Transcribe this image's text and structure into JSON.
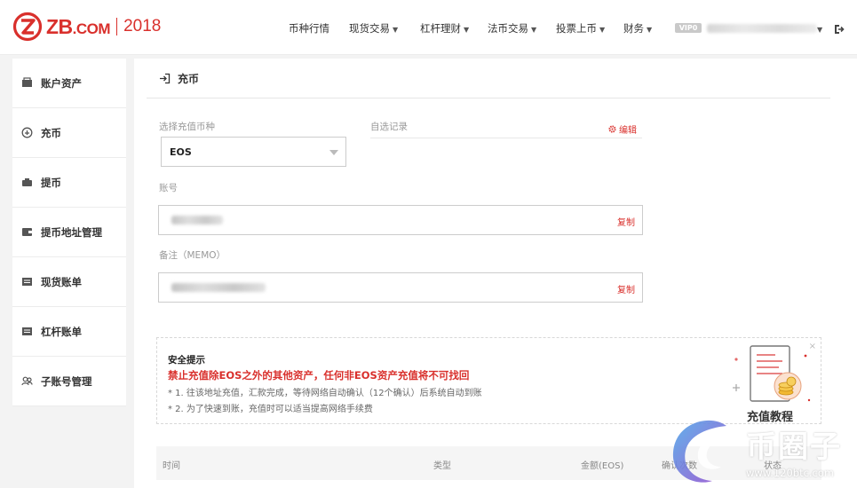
{
  "brand": {
    "name": "ZB",
    "suffix": ".COM",
    "year": "2018",
    "accent_color": "#d9302c"
  },
  "nav": {
    "items": [
      {
        "label": "币种行情",
        "has_dropdown": false
      },
      {
        "label": "现货交易",
        "has_dropdown": true
      },
      {
        "label": "杠杆理财",
        "has_dropdown": true
      },
      {
        "label": "法币交易",
        "has_dropdown": true
      },
      {
        "label": "投票上币",
        "has_dropdown": true
      },
      {
        "label": "财务",
        "has_dropdown": true
      }
    ],
    "vip_label": "VIP0",
    "logout_icon": "logout-icon"
  },
  "sidebar": {
    "items": [
      {
        "label": "账户资产",
        "icon": "wallet-icon"
      },
      {
        "label": "充币",
        "icon": "deposit-icon"
      },
      {
        "label": "提币",
        "icon": "withdraw-icon"
      },
      {
        "label": "提币地址管理",
        "icon": "address-book-icon"
      },
      {
        "label": "现货账单",
        "icon": "bill-icon"
      },
      {
        "label": "杠杆账单",
        "icon": "bill-icon"
      },
      {
        "label": "子账号管理",
        "icon": "users-icon"
      }
    ]
  },
  "deposit": {
    "title": "充币",
    "select_label": "选择充值币种",
    "selected_coin": "EOS",
    "favorites_label": "自选记录",
    "edit_label": "编辑",
    "account_label": "账号",
    "memo_label": "备注（MEMO）",
    "copy_label": "复制"
  },
  "notice": {
    "title": "安全提示",
    "warning": "禁止充值除EOS之外的其他资产，任何非EOS资产充值将不可找回",
    "lines": [
      "* 1. 往该地址充值，汇款完成，等待网络自动确认（12个确认）后系统自动到账",
      "* 2. 为了快速到账，充值时可以适当提高网络手续费"
    ],
    "close": "×",
    "tutorial_label": "充值教程"
  },
  "table": {
    "headers": [
      "时间",
      "类型",
      "金额(EOS)",
      "确认次数",
      "状态"
    ]
  },
  "watermark": {
    "text": "币圈子",
    "url": "www.120btc.com"
  }
}
